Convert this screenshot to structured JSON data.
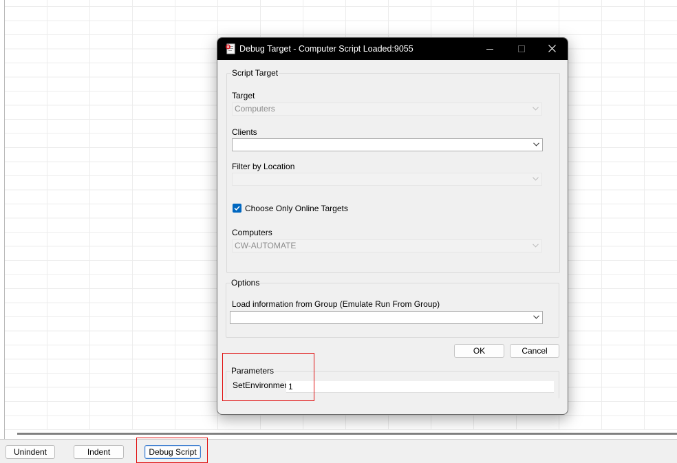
{
  "bottom_toolbar": {
    "unindent_label": "Unindent",
    "indent_label": "Indent",
    "debug_label": "Debug Script"
  },
  "dialog": {
    "title": "Debug Target - Computer Script Loaded:9055",
    "icon": "script-icon",
    "titlebar_buttons": {
      "minimize": "minimize-icon",
      "maximize": "maximize-icon",
      "close": "close-icon"
    },
    "script_target": {
      "group_label": "Script Target",
      "target_label": "Target",
      "target_value": "Computers",
      "clients_label": "Clients",
      "clients_value": "",
      "filter_label": "Filter by Location",
      "filter_value": "",
      "online_label": "Choose Only Online Targets",
      "online_checked": true,
      "computers_label": "Computers",
      "computers_value": "CW-AUTOMATE"
    },
    "options": {
      "group_label": "Options",
      "load_label": "Load information from Group (Emulate Run From Group)",
      "load_value": ""
    },
    "ok_label": "OK",
    "cancel_label": "Cancel",
    "parameters": {
      "group_label": "Parameters",
      "name": "SetEnvironment",
      "value": "1"
    }
  },
  "colors": {
    "titlebar": "#000000",
    "checkbox_accent": "#0067c0",
    "highlight_box": "#e01010",
    "dialog_bg": "#f0f0f0"
  }
}
